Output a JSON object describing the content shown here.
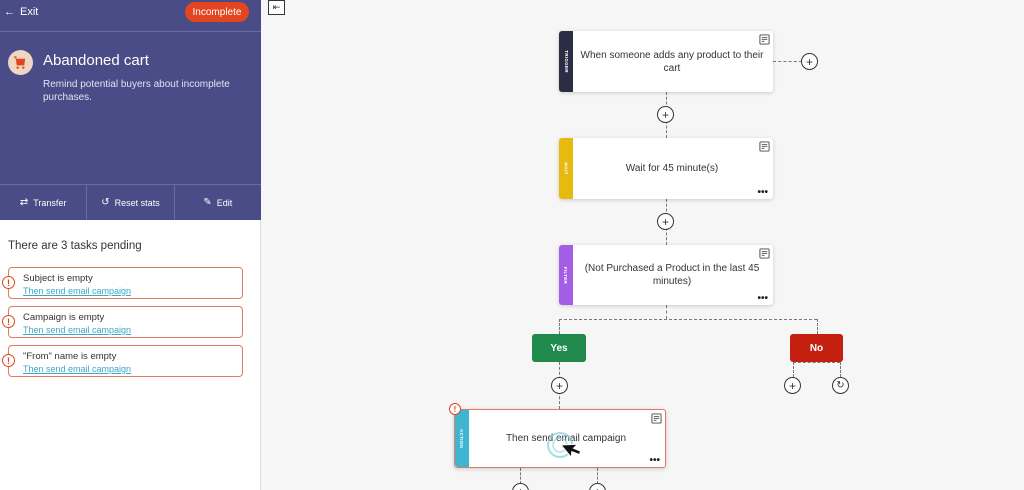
{
  "sidebar": {
    "exit_label": "Exit",
    "status_label": "Incomplete",
    "title": "Abandoned cart",
    "description": "Remind potential buyers about incomplete purchases.",
    "actions": {
      "transfer": "Transfer",
      "reset_stats": "Reset stats",
      "edit": "Edit"
    },
    "tasks_heading": "There are 3 tasks pending",
    "tasks": [
      {
        "title": "Subject is empty",
        "link": "Then send email campaign"
      },
      {
        "title": "Campaign is empty",
        "link": "Then send email campaign"
      },
      {
        "title": "\"From\" name is empty",
        "link": "Then send email campaign"
      }
    ]
  },
  "workflow": {
    "trigger": {
      "tag": "TRIGGER",
      "text": "When someone adds any product to their cart",
      "color": "#2b2d45"
    },
    "wait": {
      "tag": "WAIT",
      "text": "Wait for 45 minute(s)",
      "color": "#e8b90f"
    },
    "filter": {
      "tag": "FILTER",
      "text": "(Not Purchased a Product in the last 45 minutes)",
      "color": "#a45ee5"
    },
    "branch_yes": {
      "label": "Yes",
      "color": "#1f8a4c"
    },
    "branch_no": {
      "label": "No",
      "color": "#c4200f"
    },
    "action": {
      "tag": "ACTION",
      "text": "Then send email campaign",
      "color": "#3fb6d1"
    }
  },
  "colors": {
    "sidebar_bg": "#4a4c87",
    "incomplete_badge": "#e2451f",
    "error": "#d9471f",
    "link": "#3aa8c6"
  },
  "icons": {
    "exit": "arrow-left-icon",
    "transfer": "swap-arrows-icon",
    "reset": "history-icon",
    "edit": "pencil-icon",
    "note": "note-icon",
    "more": "more-dots-icon",
    "add": "plus-icon",
    "refresh": "refresh-icon",
    "collapse": "collapse-left-icon"
  }
}
